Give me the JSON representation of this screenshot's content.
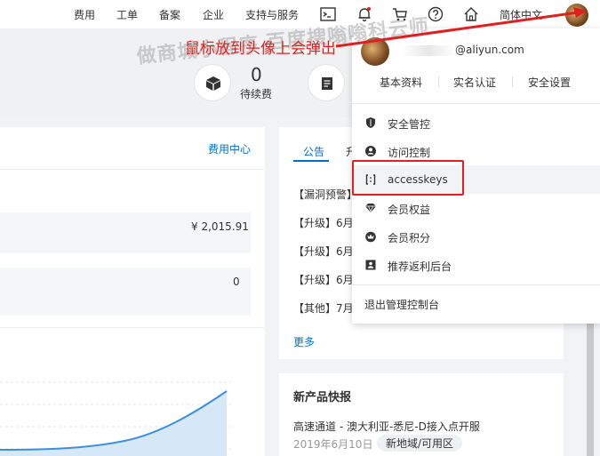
{
  "nav": {
    "items": [
      "费用",
      "工单",
      "备案",
      "企业",
      "支持与服务"
    ],
    "language": "简体中文"
  },
  "header": {
    "pending_count": "0",
    "pending_label": "待续费"
  },
  "left_card": {
    "link": "费用中心",
    "amount": "¥ 2,015.91",
    "second_value": "0"
  },
  "notice": {
    "tab_active": "公告",
    "tab_other": "升",
    "lines": [
      "【漏洞预警】",
      "【升级】6月",
      "【升级】6月",
      "【升级】6月",
      "【其他】7月"
    ],
    "more": "更多"
  },
  "news": {
    "title": "新产品快报",
    "item_title": "高速通道 - 澳大利亚-悉尼-D接入点开服",
    "item_date": "2019年6月10日",
    "item_tag": "新地域/可用区"
  },
  "dropdown": {
    "email_suffix": "@aliyun.com",
    "links": [
      "基本资料",
      "实名认证",
      "安全设置"
    ],
    "items": [
      {
        "label": "安全管控",
        "icon": "shield-icon"
      },
      {
        "label": "访问控制",
        "icon": "user-circle-icon"
      },
      {
        "label": "accesskeys",
        "icon": "key-bracket-icon"
      },
      {
        "label": "会员权益",
        "icon": "diamond-icon"
      },
      {
        "label": "会员积分",
        "icon": "points-icon"
      },
      {
        "label": "推荐返利后台",
        "icon": "referral-icon"
      }
    ],
    "logout": "退出管理控制台"
  },
  "annotation": {
    "red_text": "鼠标放到头像上会弹出",
    "watermark": "做商城小程序 百度搜嗡嗡科云师"
  },
  "colors": {
    "accent_blue": "#0070cc",
    "highlight_red": "#e02020"
  }
}
